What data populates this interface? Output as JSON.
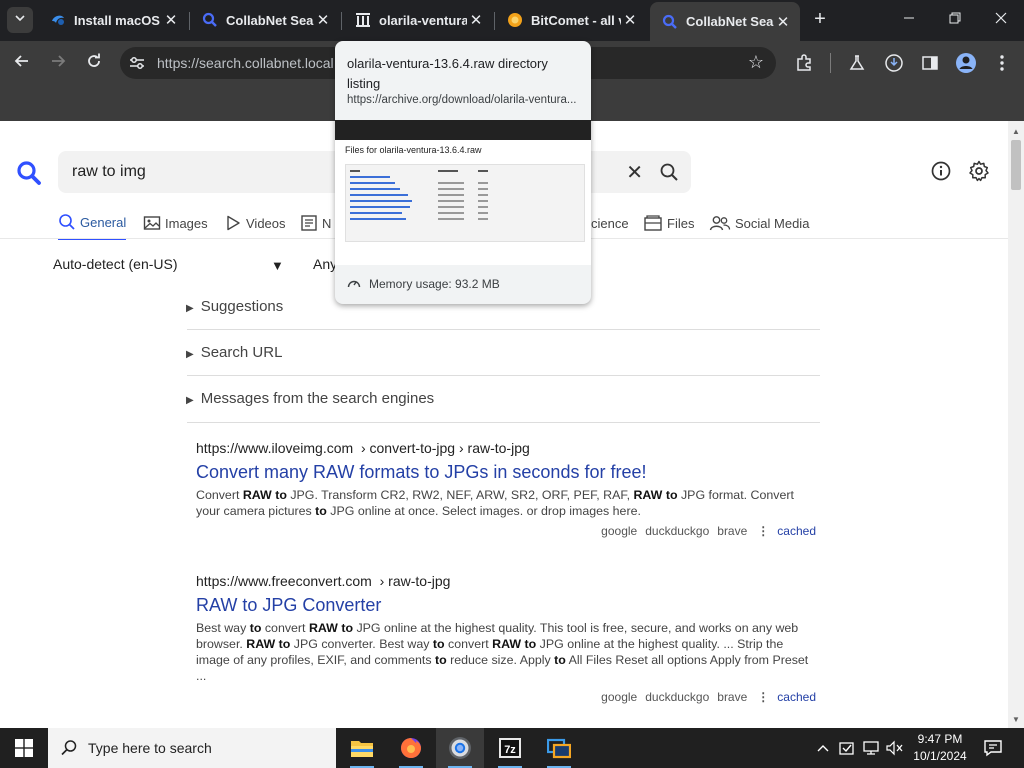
{
  "browser": {
    "tabs": [
      {
        "title": "Install macOS M",
        "icon": "blue-logo-icon"
      },
      {
        "title": "CollabNet Sear",
        "icon": "search-icon"
      },
      {
        "title": "olarila-ventura",
        "icon": "archive-icon"
      },
      {
        "title": "BitComet - all v",
        "icon": "bitcomet-icon"
      },
      {
        "title": "CollabNet Sear",
        "icon": "search-icon"
      }
    ],
    "url": "https://search.collabnet.local",
    "hover_card": {
      "title": "olarila-ventura-13.6.4.raw directory listing",
      "url": "https://archive.org/download/olarila-ventura...",
      "preview_heading": "Files for olarila-ventura-13.6.4.raw",
      "memory": "Memory usage: 93.2 MB"
    }
  },
  "search": {
    "query": "raw to img",
    "categories": [
      {
        "label": "General",
        "icon": "search-icon",
        "active": true
      },
      {
        "label": "Images",
        "icon": "image-icon"
      },
      {
        "label": "Videos",
        "icon": "play-icon"
      },
      {
        "label": "N",
        "icon": "news-icon"
      },
      {
        "label": "cience",
        "icon": "science-icon"
      },
      {
        "label": "Files",
        "icon": "files-icon"
      },
      {
        "label": "Social Media",
        "icon": "people-icon"
      }
    ],
    "language": "Auto-detect (en-US)",
    "time_range": "Any",
    "expanders": [
      "Suggestions",
      "Search URL",
      "Messages from the search engines"
    ],
    "results": [
      {
        "url": "https://www.iloveimg.com",
        "breadcrumb": "› convert-to-jpg › raw-to-jpg",
        "title": "Convert many RAW formats to JPGs in seconds for free!",
        "snippet_html": "Convert <b>RAW</b> <b>to</b> JPG. Transform CR2, RW2, NEF, ARW, SR2, ORF, PEF, RAF, <b>RAW</b> <b>to</b> JPG format. Convert your camera pictures <b>to</b> JPG online at once. Select images. or drop images here.",
        "engines": [
          "google",
          "duckduckgo",
          "brave"
        ],
        "cached": "cached"
      },
      {
        "url": "https://www.freeconvert.com",
        "breadcrumb": "› raw-to-jpg",
        "title": "RAW to JPG Converter",
        "snippet_html": "Best way <b>to</b> convert <b>RAW</b> <b>to</b> JPG online at the highest quality. This tool is free, secure, and works on any web browser. <b>RAW</b> <b>to</b> JPG converter. Best way <b>to</b> convert <b>RAW</b> <b>to</b> JPG online at the highest quality. ... Strip the image of any profiles, EXIF, and comments <b>to</b> reduce size. Apply <b>to</b> All Files Reset all options Apply from Preset ...",
        "engines": [
          "google",
          "duckduckgo",
          "brave"
        ],
        "cached": "cached"
      }
    ]
  },
  "taskbar": {
    "search_placeholder": "Type here to search",
    "time": "9:47 PM",
    "date": "10/1/2024",
    "apps": [
      "file-explorer-icon",
      "firefox-icon",
      "chrome-icon",
      "7zip-icon",
      "virtual-machine-icon"
    ]
  },
  "colors": {
    "accent": "#3050ff",
    "link": "#2440a6",
    "chrome_dark": "#202124"
  }
}
